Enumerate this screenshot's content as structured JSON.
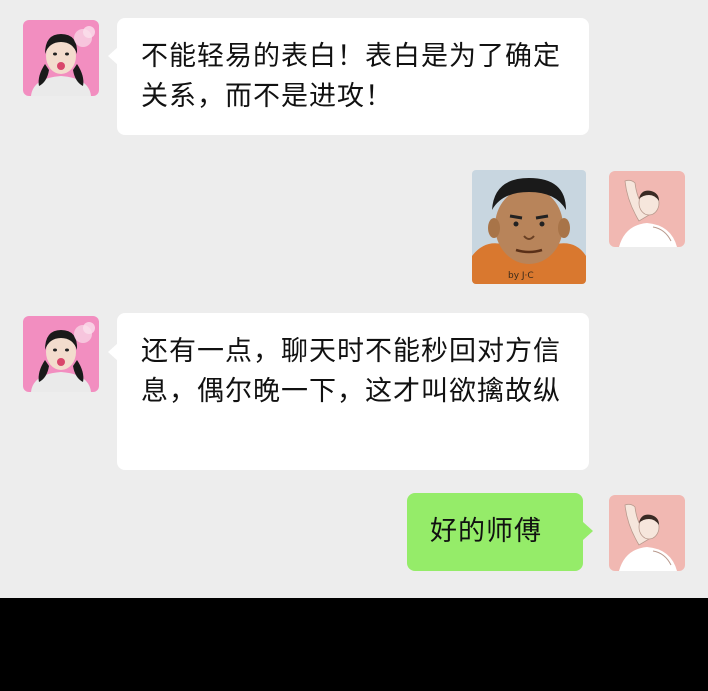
{
  "messages": [
    {
      "sender": "other",
      "type": "text",
      "text": "不能轻易的表白！表白是为了确定关系，而不是进攻！"
    },
    {
      "sender": "self",
      "type": "sticker",
      "sticker": "cartoon-man-face",
      "caption": "by J·C"
    },
    {
      "sender": "other",
      "type": "text",
      "text": "还有一点，聊天时不能秒回对方信息，偶尔晚一下，这才叫欲擒故纵"
    },
    {
      "sender": "self",
      "type": "text",
      "text": "好的师傅"
    }
  ],
  "colors": {
    "chat_background": "#ededed",
    "incoming_bubble": "#ffffff",
    "outgoing_bubble": "#95ec69",
    "other_avatar_bg": "#f28ec0",
    "self_avatar_bg": "#f1b8b2"
  },
  "icons": [
    "avatar-girl-icon",
    "avatar-woman-stretching-icon",
    "cartoon-face-sticker"
  ]
}
